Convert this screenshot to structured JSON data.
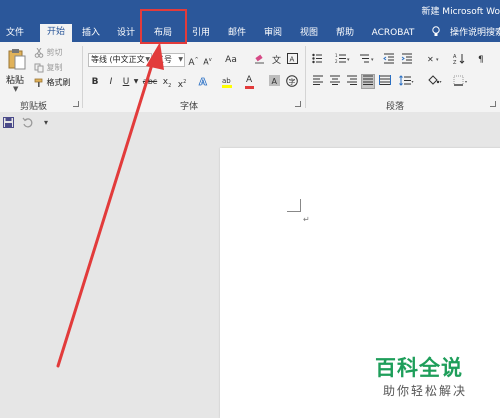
{
  "window": {
    "title": "新建 Microsoft Wo"
  },
  "tabs": [
    {
      "label": "文件"
    },
    {
      "label": "开始"
    },
    {
      "label": "插入"
    },
    {
      "label": "设计"
    },
    {
      "label": "布局"
    },
    {
      "label": "引用"
    },
    {
      "label": "邮件"
    },
    {
      "label": "审阅"
    },
    {
      "label": "视图"
    },
    {
      "label": "帮助"
    },
    {
      "label": "ACROBAT"
    },
    {
      "label": "操作说明搜索"
    }
  ],
  "active_tab": "开始",
  "highlighted_tab": "布局",
  "clipboard": {
    "paste_label": "粘贴",
    "cut_label": "剪切",
    "copy_label": "复制",
    "format_painter_label": "格式刷",
    "group_label": "剪贴板"
  },
  "font": {
    "font_name": "等线 (中文正文",
    "font_size": "五号",
    "grow_label": "A",
    "shrink_label": "A",
    "case_label": "Aa",
    "bold_label": "B",
    "italic_label": "I",
    "underline_label": "U",
    "strike_label": "abc",
    "subscript_label": "x",
    "superscript_label": "x",
    "color_label": "A",
    "group_label": "字体"
  },
  "paragraph": {
    "group_label": "段落"
  },
  "watermark": {
    "title": "百科全说",
    "subtitle": "助你轻松解决"
  },
  "colors": {
    "brand": "#2b579a",
    "annotation": "#e23b3b",
    "watermark": "#1e9e5a"
  }
}
